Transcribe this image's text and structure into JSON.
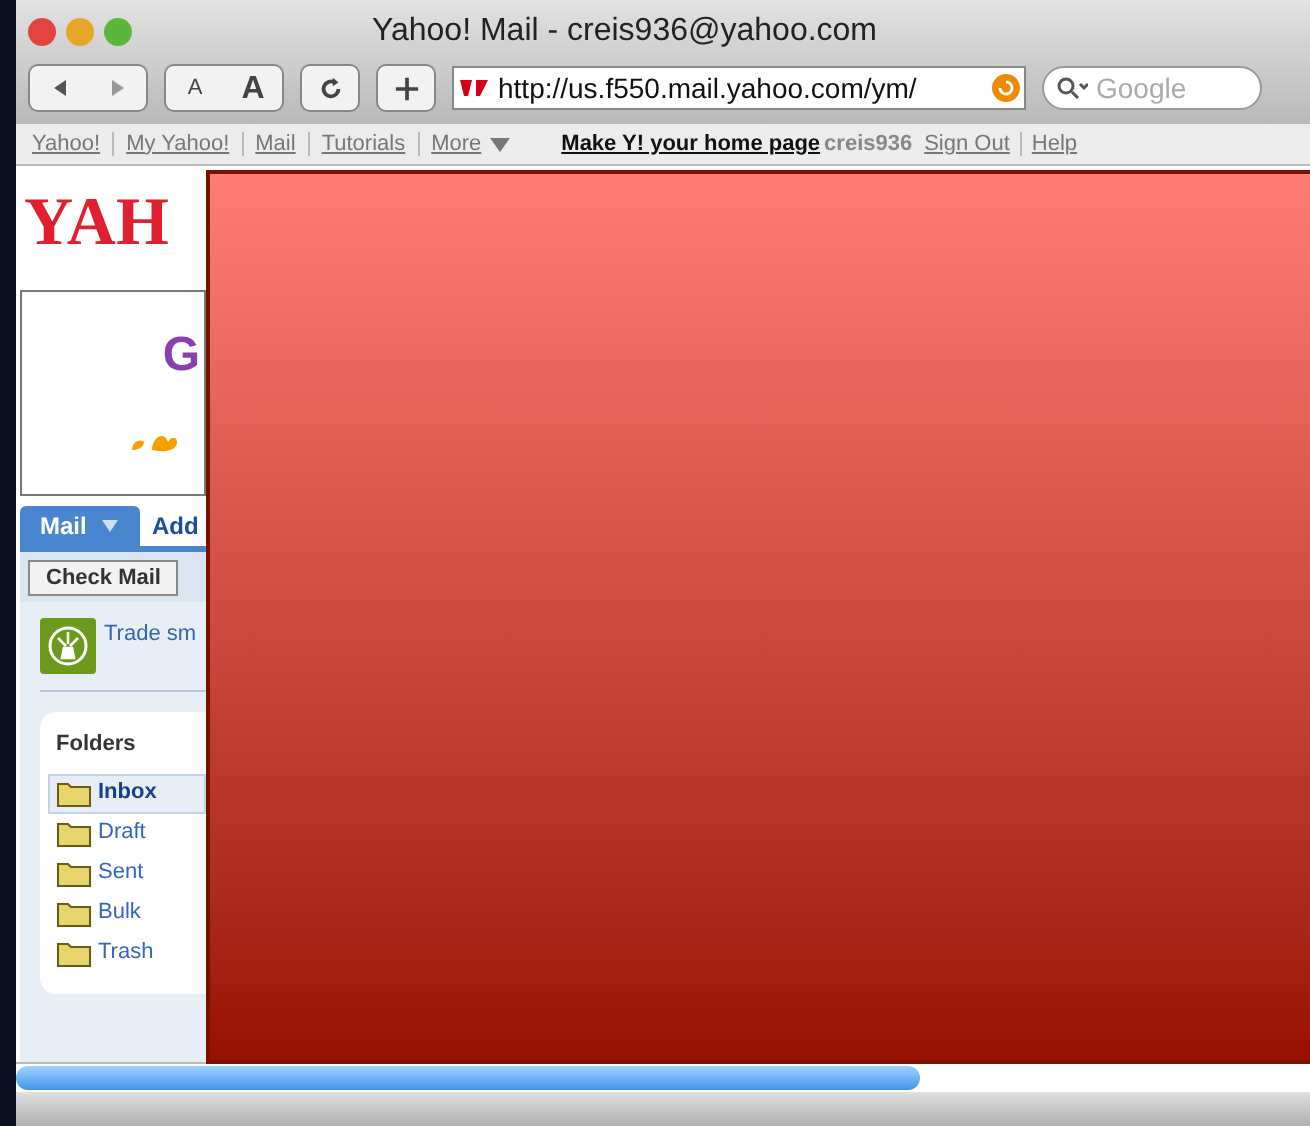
{
  "window": {
    "title": "Yahoo! Mail - creis936@yahoo.com"
  },
  "toolbar": {
    "text_size_small": "A",
    "text_size_large": "A",
    "address": "http://us.f550.mail.yahoo.com/ym/",
    "search": {
      "placeholder": "Google"
    }
  },
  "nav_links": [
    {
      "label": "Yahoo!"
    },
    {
      "label": "My Yahoo!"
    },
    {
      "label": "Mail"
    },
    {
      "label": "Tutorials"
    },
    {
      "label": "More"
    }
  ],
  "header_right": {
    "home_page_link": "Make Y! your home page",
    "username": "creis936",
    "links": [
      "Sign Out",
      "Help"
    ]
  },
  "logo": "YAH",
  "ad": {
    "letter": "G"
  },
  "mail_tabs": [
    {
      "label": "Mail",
      "selected": true
    },
    {
      "label": "Add",
      "selected": false
    }
  ],
  "check_mail_button": "Check Mail",
  "promo": "Trade sm",
  "folders": {
    "title": "Folders",
    "items": [
      {
        "label": "Inbox",
        "selected": true
      },
      {
        "label": "Draft",
        "selected": false
      },
      {
        "label": "Sent",
        "selected": false
      },
      {
        "label": "Bulk",
        "selected": false
      },
      {
        "label": "Trash",
        "selected": false
      }
    ]
  }
}
